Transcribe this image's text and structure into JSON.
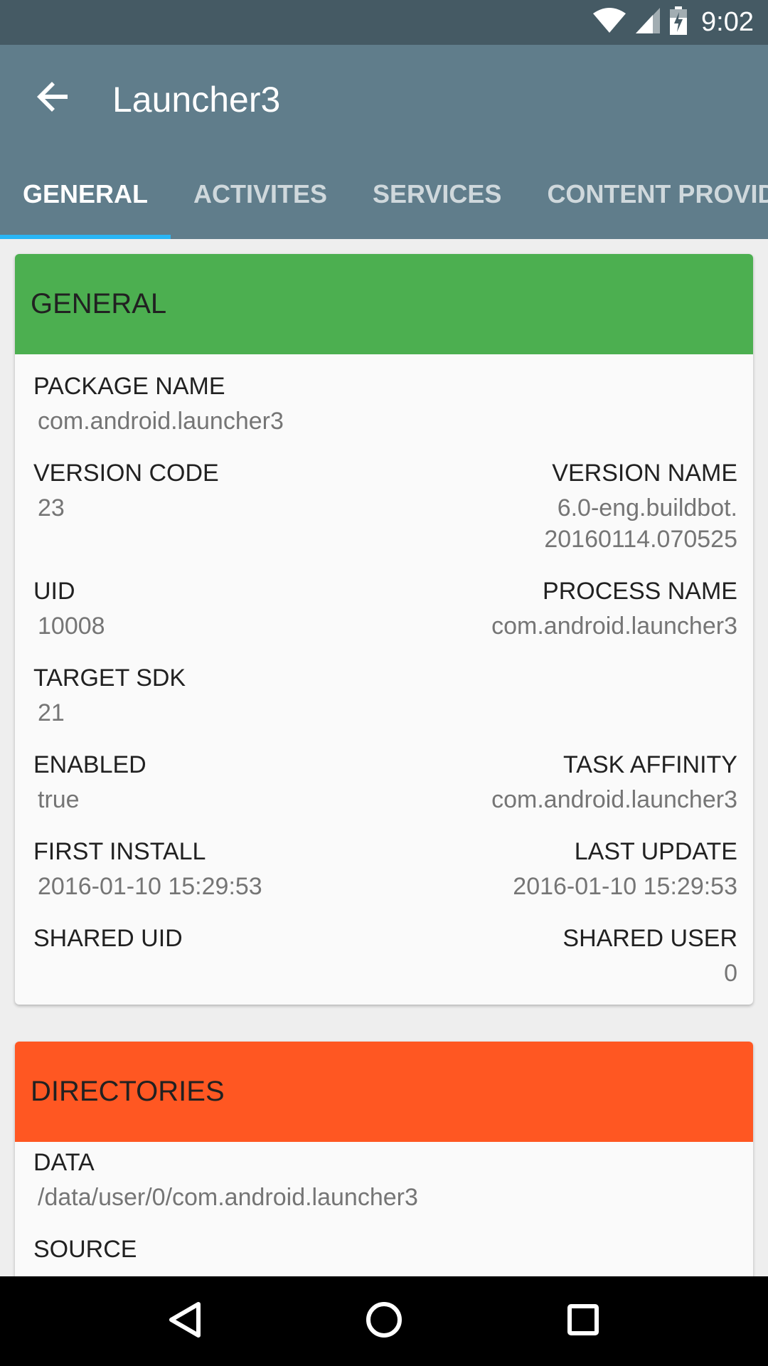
{
  "status_bar": {
    "time": "9:02",
    "icons": [
      "wifi-icon",
      "signal-icon",
      "battery-icon"
    ]
  },
  "app_bar": {
    "title": "Launcher3",
    "back_icon": "arrow-back-icon",
    "tabs": [
      {
        "label": "GENERAL",
        "active": true
      },
      {
        "label": "ACTIVITES",
        "active": false
      },
      {
        "label": "SERVICES",
        "active": false
      },
      {
        "label": "CONTENT PROVIDER",
        "active": false
      }
    ],
    "indicator_color": "#29b6f6"
  },
  "general_card": {
    "header": "GENERAL",
    "header_color": "#4caf50",
    "package_name_label": "PACKAGE NAME",
    "package_name": "com.android.launcher3",
    "version_code_label": "VERSION CODE",
    "version_code": "23",
    "version_name_label": "VERSION NAME",
    "version_name_line1": "6.0-eng.buildbot.",
    "version_name_line2": "20160114.070525",
    "uid_label": "UID",
    "uid": "10008",
    "process_name_label": "PROCESS NAME",
    "process_name": "com.android.launcher3",
    "target_sdk_label": "TARGET SDK",
    "target_sdk": "21",
    "enabled_label": "ENABLED",
    "enabled": "true",
    "task_affinity_label": "TASK AFFINITY",
    "task_affinity": "com.android.launcher3",
    "first_install_label": "FIRST INSTALL",
    "first_install": "2016-01-10 15:29:53",
    "last_update_label": "LAST UPDATE",
    "last_update": "2016-01-10 15:29:53",
    "shared_uid_label": "SHARED UID",
    "shared_user_label": "SHARED USER",
    "shared_user": "0"
  },
  "directories_card": {
    "header": "DIRECTORIES",
    "header_color": "#ff5722",
    "data_label": "DATA",
    "data": "/data/user/0/com.android.launcher3",
    "source_label": "SOURCE"
  },
  "nav_bar": {
    "icons": [
      "back-triangle-icon",
      "home-circle-icon",
      "recents-square-icon"
    ]
  }
}
